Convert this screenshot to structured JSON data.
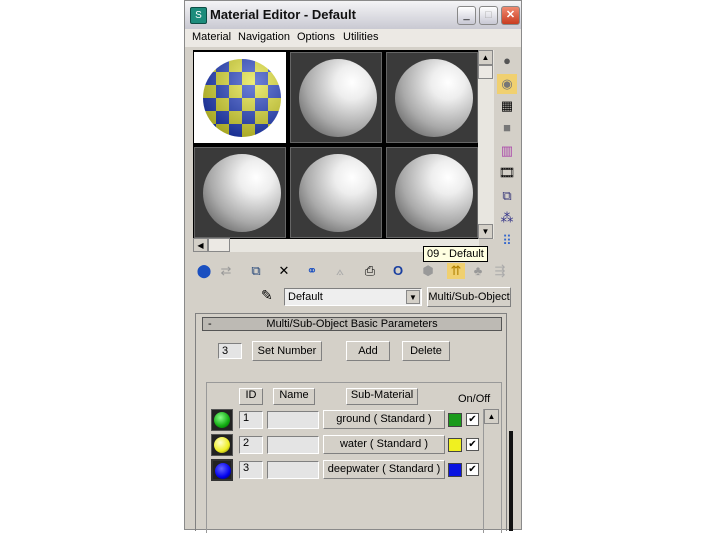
{
  "window": {
    "title": "Material Editor - Default",
    "minimize": "_",
    "maximize": "□",
    "close": "✕"
  },
  "menu": [
    "Material",
    "Navigation",
    "Options",
    "Utilities"
  ],
  "tooltip": "09 - Default",
  "material_name": "Default",
  "material_type": "Multi/Sub-Object",
  "rollout": {
    "title": "Multi/Sub-Object Basic Parameters",
    "collapse": "-",
    "count": "3",
    "set_number": "Set Number",
    "add": "Add",
    "delete": "Delete"
  },
  "table": {
    "headers": {
      "id": "ID",
      "name": "Name",
      "sub": "Sub-Material",
      "onoff": "On/Off"
    },
    "rows": [
      {
        "id": "1",
        "name": "",
        "sub": "ground  ( Standard )",
        "color": "#1a9a1a",
        "checked": "✔"
      },
      {
        "id": "2",
        "name": "",
        "sub": "water  ( Standard )",
        "color": "#f0f020",
        "checked": "✔"
      },
      {
        "id": "3",
        "name": "",
        "sub": "deepwater  ( Standard )",
        "color": "#0a14e0",
        "checked": "✔"
      }
    ]
  }
}
